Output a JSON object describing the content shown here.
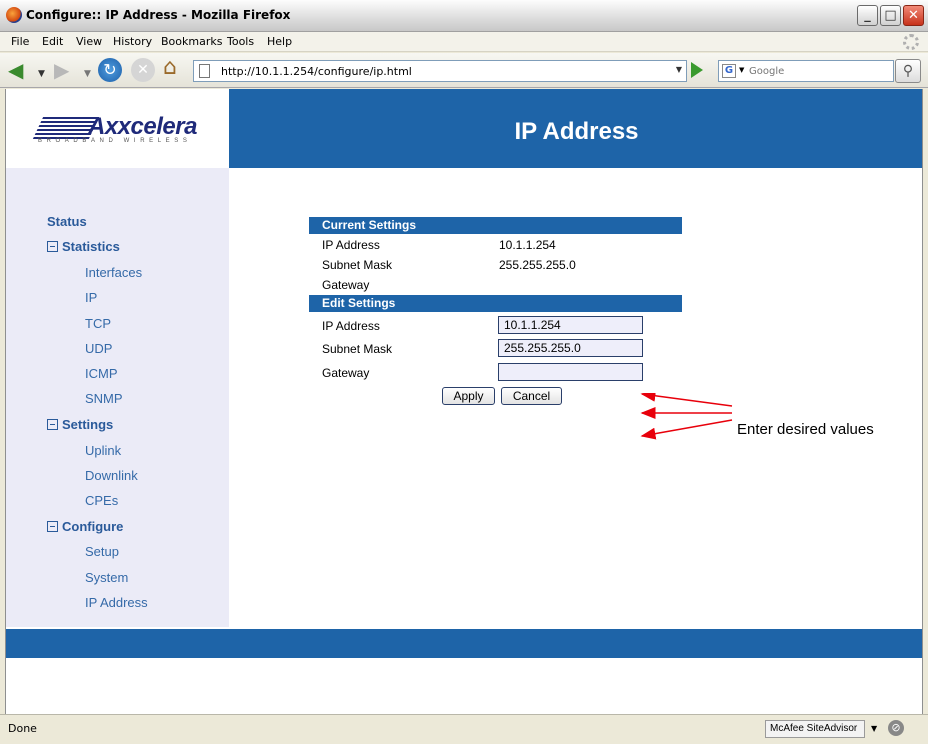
{
  "window": {
    "title": "Configure:: IP Address - Mozilla Firefox",
    "controls": {
      "minimize": "_",
      "maximize": "□",
      "close": "✕"
    }
  },
  "menubar": {
    "items": [
      "File",
      "Edit",
      "View",
      "History",
      "Bookmarks",
      "Tools",
      "Help"
    ]
  },
  "toolbar": {
    "url": "http://10.1.1.254/configure/ip.html",
    "search_placeholder": "Google",
    "search_engine_icon": "G"
  },
  "header": {
    "logo_text": "Axxcelera",
    "logo_tagline": "BROADBAND WIRELESS",
    "page_title": "IP Address"
  },
  "sidebar": {
    "status": "Status",
    "statistics": {
      "label": "Statistics",
      "items": [
        "Interfaces",
        "IP",
        "TCP",
        "UDP",
        "ICMP",
        "SNMP"
      ]
    },
    "settings": {
      "label": "Settings",
      "items": [
        "Uplink",
        "Downlink",
        "CPEs"
      ]
    },
    "configure": {
      "label": "Configure",
      "items": [
        "Setup",
        "System",
        "IP Address"
      ]
    }
  },
  "current_settings": {
    "heading": "Current Settings",
    "rows": [
      {
        "label": "IP Address",
        "value": "10.1.1.254"
      },
      {
        "label": "Subnet Mask",
        "value": "255.255.255.0"
      },
      {
        "label": "Gateway",
        "value": ""
      }
    ]
  },
  "edit_settings": {
    "heading": "Edit Settings",
    "fields": [
      {
        "label": "IP Address",
        "value": "10.1.1.254"
      },
      {
        "label": "Subnet Mask",
        "value": "255.255.255.0"
      },
      {
        "label": "Gateway",
        "value": ""
      }
    ],
    "apply_label": "Apply",
    "cancel_label": "Cancel"
  },
  "annotation": {
    "text": "Enter desired values",
    "arrow_color": "#e8000b"
  },
  "statusbar": {
    "text": "Done",
    "addon_label": "McAfee SiteAdvisor"
  },
  "colors": {
    "brand_blue": "#1e64a8",
    "sidebar_bg": "#ebebf7",
    "nav_text": "#2a5a9a"
  }
}
